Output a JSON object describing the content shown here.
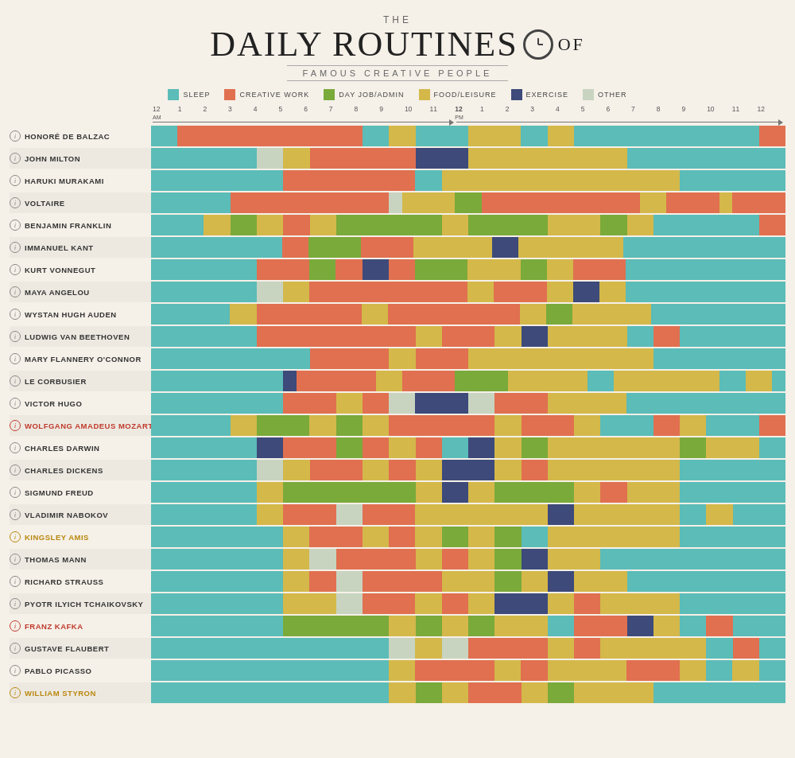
{
  "title": {
    "the": "THE",
    "main": "DAILY ROUTINES",
    "of": "OF",
    "sub": "FAMOUS CREATIVE PEOPLE"
  },
  "legend": [
    {
      "id": "sleep",
      "label": "SLEEP",
      "color": "#5bbcb8"
    },
    {
      "id": "creative",
      "label": "CREATIVE WORK",
      "color": "#e07050"
    },
    {
      "id": "dayjob",
      "label": "DAY JOB/ADMIN",
      "color": "#7aaa3a"
    },
    {
      "id": "food",
      "label": "FOOD/LEISURE",
      "color": "#d4b84a"
    },
    {
      "id": "exercise",
      "label": "EXERCISE",
      "color": "#3d4a7a"
    },
    {
      "id": "other",
      "label": "OTHER",
      "color": "#c8d4c0"
    }
  ],
  "time_labels": [
    "12",
    "1",
    "2",
    "3",
    "4",
    "5",
    "6",
    "7",
    "8",
    "9",
    "10",
    "11",
    "12",
    "1",
    "2",
    "3",
    "4",
    "5",
    "6",
    "7",
    "8",
    "9",
    "10",
    "11",
    "12"
  ],
  "people": [
    {
      "name": "HONORÉ DE BALZAC",
      "style": "normal"
    },
    {
      "name": "JOHN MILTON",
      "style": "normal"
    },
    {
      "name": "HARUKI MURAKAMI",
      "style": "normal"
    },
    {
      "name": "VOLTAIRE",
      "style": "normal"
    },
    {
      "name": "BENJAMIN FRANKLIN",
      "style": "normal"
    },
    {
      "name": "IMMANUEL KANT",
      "style": "normal"
    },
    {
      "name": "KURT VONNEGUT",
      "style": "normal"
    },
    {
      "name": "MAYA ANGELOU",
      "style": "normal"
    },
    {
      "name": "WYSTAN HUGH AUDEN",
      "style": "normal"
    },
    {
      "name": "LUDWIG VAN BEETHOVEN",
      "style": "normal"
    },
    {
      "name": "MARY FLANNERY O'CONNOR",
      "style": "normal"
    },
    {
      "name": "LE CORBUSIER",
      "style": "normal"
    },
    {
      "name": "VICTOR HUGO",
      "style": "normal"
    },
    {
      "name": "WOLFGANG AMADEUS MOZART",
      "style": "highlight"
    },
    {
      "name": "CHARLES DARWIN",
      "style": "normal"
    },
    {
      "name": "CHARLES DICKENS",
      "style": "normal"
    },
    {
      "name": "SIGMUND FREUD",
      "style": "normal"
    },
    {
      "name": "VLADIMIR NABOKOV",
      "style": "normal"
    },
    {
      "name": "KINGSLEY AMIS",
      "style": "gold"
    },
    {
      "name": "THOMAS MANN",
      "style": "normal"
    },
    {
      "name": "RICHARD STRAUSS",
      "style": "normal"
    },
    {
      "name": "PYOTR ILYICH TCHAIKOVSKY",
      "style": "normal"
    },
    {
      "name": "FRANZ KAFKA",
      "style": "highlight"
    },
    {
      "name": "GUSTAVE FLAUBERT",
      "style": "normal"
    },
    {
      "name": "PABLO PICASSO",
      "style": "normal"
    },
    {
      "name": "WILLIAM STYRON",
      "style": "gold"
    }
  ]
}
